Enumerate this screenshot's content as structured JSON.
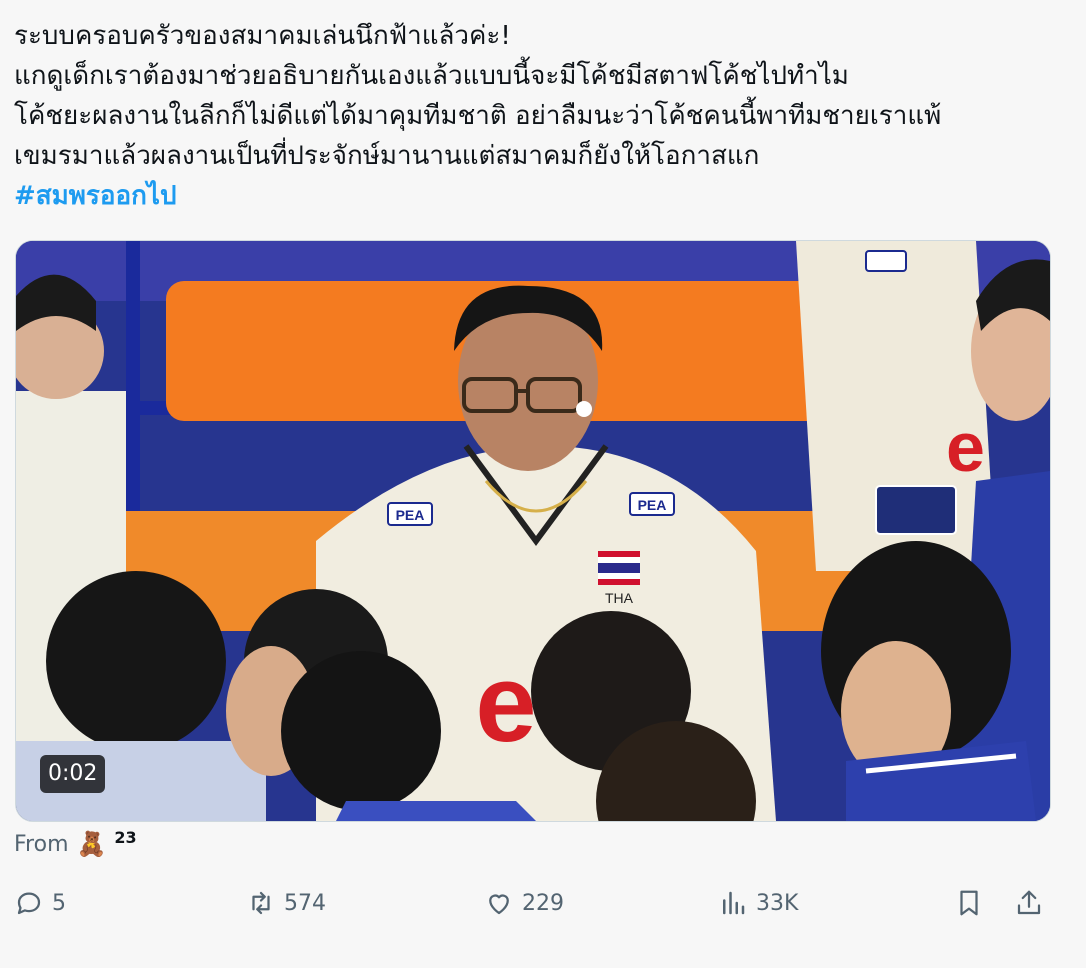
{
  "post": {
    "lines": [
      "ระบบครอบครัวของสมาคมเล่นนึกฟ้าแล้วค่ะ!",
      "แกดูเด็กเราต้องมาช่วยอธิบายกันเองแล้วแบบนี้จะมีโค้ชมีสตาฟโค้ชไปทำไม",
      "โค้ชยะผลงานในลีกก็ไม่ดีแต่ได้มาคุมทีมชาติ อย่าลืมนะว่าโค้ชคนนี้พาทีมชายเราแพ้",
      "เขมรมาแล้วผลงานเป็นที่ประจักษ์มานานแต่สมาคมก็ยังให้โอกาสแก"
    ],
    "hashtag": "#สมพรออกไป"
  },
  "media": {
    "duration": "0:02",
    "jersey_text": "PEA",
    "country_code": "THA"
  },
  "from": {
    "label": "From",
    "icon": "teddy-bear-emoji",
    "bear": "🧸",
    "count": "23"
  },
  "actions": {
    "replies": "5",
    "reposts": "574",
    "likes": "229",
    "views": "33K"
  },
  "colors": {
    "accent": "#1d9bf0",
    "muted": "#536471",
    "text": "#0f1419"
  }
}
